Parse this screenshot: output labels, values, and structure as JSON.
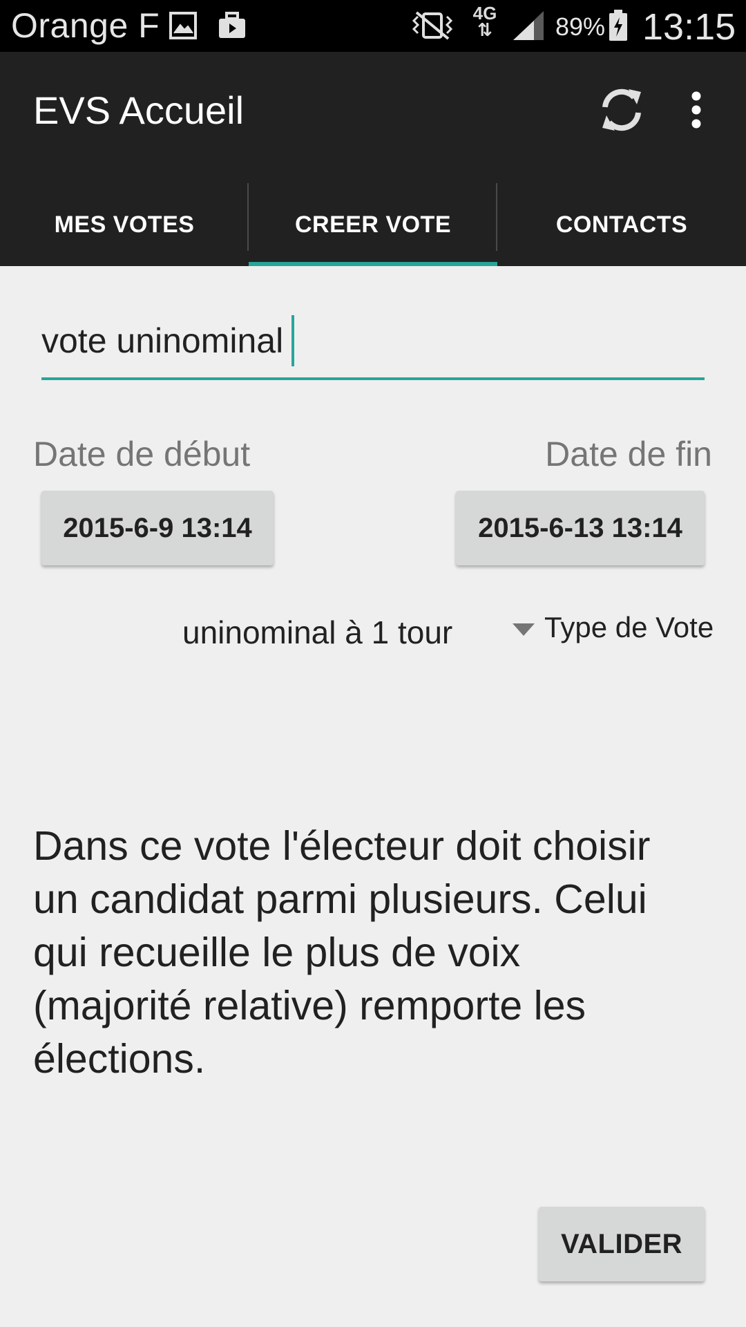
{
  "status_bar": {
    "carrier": "Orange F",
    "network": "4G",
    "battery": "89%",
    "time": "13:15",
    "icons": [
      "gallery-icon",
      "bag-icon",
      "mute-vibrate-icon",
      "data-arrows-icon",
      "signal-icon",
      "battery-charging-icon"
    ]
  },
  "action_bar": {
    "title": "EVS Accueil",
    "icons": [
      "refresh-icon",
      "overflow-menu-icon"
    ]
  },
  "tabs": [
    {
      "label": "MES VOTES",
      "active": false
    },
    {
      "label": "CREER VOTE",
      "active": true
    },
    {
      "label": "CONTACTS",
      "active": false
    }
  ],
  "form": {
    "vote_name": "vote uninominal",
    "start_label": "Date de début",
    "end_label": "Date de fin",
    "start_date": "2015-6-9 13:14",
    "end_date": "2015-6-13 13:14",
    "vote_type_value": "uninominal à 1 tour",
    "vote_type_label": "Type de Vote",
    "description": "Dans ce vote l'électeur doit choisir un candidat parmi plusieurs. Celui qui recueille le plus de voix (majorité relative) remporte les élections.",
    "submit_label": "VALIDER"
  },
  "colors": {
    "accent": "#26a69a",
    "action_bar": "#212121",
    "background": "#efefef",
    "button": "#d6d7d7"
  }
}
